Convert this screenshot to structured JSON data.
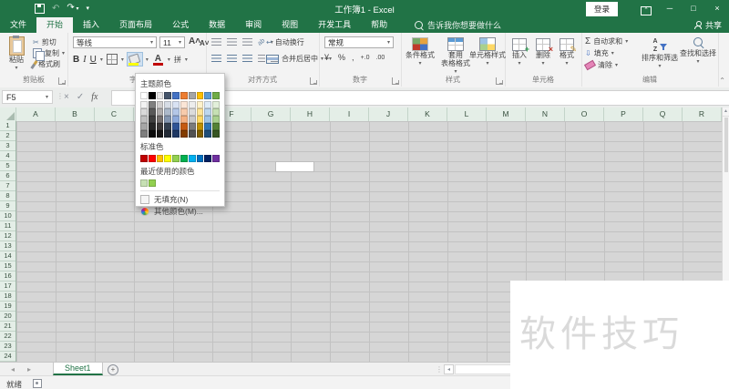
{
  "titlebar": {
    "title": "工作簿1 - Excel",
    "signin": "登录"
  },
  "ribbon_tabs": [
    "文件",
    "开始",
    "插入",
    "页面布局",
    "公式",
    "数据",
    "审阅",
    "视图",
    "开发工具",
    "帮助"
  ],
  "active_tab": "开始",
  "tellme": "告诉我你想要做什么",
  "share": "共享",
  "ribbon": {
    "clipboard": {
      "label": "剪贴板",
      "paste": "粘贴",
      "cut": "剪切",
      "copy": "复制",
      "painter": "格式刷"
    },
    "font": {
      "label": "字体",
      "font_name": "等线",
      "font_size": "11",
      "bold": "B",
      "italic": "I",
      "underline": "U",
      "phonetic": "拼"
    },
    "alignment": {
      "label": "对齐方式",
      "wrap": "自动换行",
      "merge": "合并后居中"
    },
    "number": {
      "label": "数字",
      "format": "常规",
      "currency": "¥",
      "percent": "%",
      "comma": ",",
      "inc_dec": "+.0",
      "dec_dec": ".00"
    },
    "styles": {
      "label": "样式",
      "conditional": "条件格式",
      "table_line1": "套用",
      "table_line2": "表格格式",
      "cell_styles": "单元格样式"
    },
    "cells": {
      "label": "单元格",
      "insert": "插入",
      "delete": "删除",
      "format": "格式"
    },
    "editing": {
      "label": "编辑",
      "autosum": "自动求和",
      "fill": "填充",
      "clear": "清除",
      "sort": "排序和筛选",
      "find": "查找和选择",
      "sigma": "Σ"
    }
  },
  "formula_bar": {
    "name_box": "F5",
    "fx": "fx"
  },
  "color_picker": {
    "theme_label": "主题颜色",
    "standard_label": "标准色",
    "recent_label": "最近使用的颜色",
    "no_fill": "无填充(N)",
    "more_colors": "其他颜色(M)...",
    "theme_colors": [
      "#FFFFFF",
      "#000000",
      "#E7E6E6",
      "#44546A",
      "#4472C4",
      "#ED7D31",
      "#A5A5A5",
      "#FFC000",
      "#5B9BD5",
      "#70AD47"
    ],
    "variants": [
      [
        "#F2F2F2",
        "#7F7F7F",
        "#D0CECE",
        "#D6DCE5",
        "#D9E2F3",
        "#FBE5D6",
        "#EDEDED",
        "#FFF2CC",
        "#DEEBF7",
        "#E2EFDA"
      ],
      [
        "#D9D9D9",
        "#595959",
        "#AEABAB",
        "#ACB9CA",
        "#B4C7E7",
        "#F7CBAC",
        "#DBDBDB",
        "#FFE599",
        "#BDD7EE",
        "#C6E0B4"
      ],
      [
        "#BFBFBF",
        "#3F3F3F",
        "#767171",
        "#8496B0",
        "#8EAADB",
        "#F4B183",
        "#C9C9C9",
        "#FFD966",
        "#9DC3E6",
        "#A9D08E"
      ],
      [
        "#A6A6A6",
        "#262626",
        "#3B3838",
        "#333F4F",
        "#2F5496",
        "#C55A11",
        "#7B7B7B",
        "#BF8F00",
        "#2E75B6",
        "#548235"
      ],
      [
        "#7F7F7F",
        "#0C0C0C",
        "#171616",
        "#222A35",
        "#1F3864",
        "#833C00",
        "#525252",
        "#7F5F00",
        "#1F4E79",
        "#375623"
      ]
    ],
    "standard_colors": [
      "#C00000",
      "#FF0000",
      "#FFC000",
      "#FFFF00",
      "#92D050",
      "#00B050",
      "#00B0F0",
      "#0070C0",
      "#002060",
      "#7030A0"
    ],
    "recent_colors": [
      "#C6E0B4",
      "#92D050"
    ]
  },
  "grid": {
    "columns": [
      "A",
      "B",
      "C",
      "D",
      "E",
      "F",
      "G",
      "H",
      "I",
      "J",
      "K",
      "L",
      "M",
      "N",
      "O",
      "P",
      "Q",
      "R"
    ],
    "rows": [
      1,
      2,
      3,
      4,
      5,
      6,
      7,
      8,
      9,
      10,
      11,
      12,
      13,
      14,
      15,
      16,
      17,
      18,
      19,
      20,
      21,
      22,
      23,
      24
    ],
    "active_cell": "F5"
  },
  "sheet_tabs": {
    "active": "Sheet1"
  },
  "status_bar": {
    "status": "就绪"
  },
  "watermark": "软件技巧",
  "colors": {
    "excel_green": "#217346",
    "selection_gray": "#d6d6d6",
    "header_tint": "#e4eee7",
    "fill_button_color": "#FFFF00",
    "font_color_button": "#C00000"
  }
}
